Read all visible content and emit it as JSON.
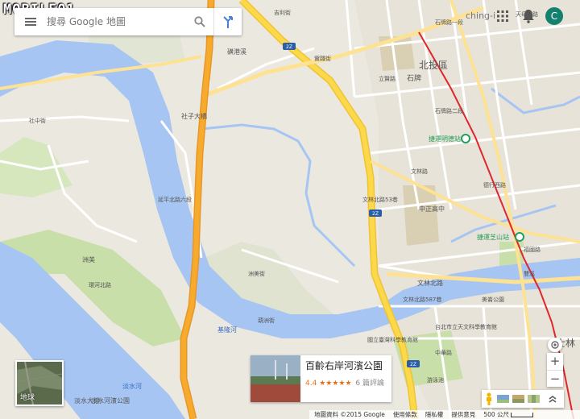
{
  "watermark": "MOBILE01",
  "search": {
    "placeholder": "搜尋 Google 地圖"
  },
  "account": {
    "name": "ching-i",
    "avatar_letter": "C"
  },
  "place_card": {
    "name": "百齡右岸河濱公園",
    "rating": "4.4",
    "stars": "★★★★★",
    "reviews": "6 篇評論"
  },
  "earth_toggle": {
    "label": "地球"
  },
  "zoom": {
    "in": "+",
    "out": "−"
  },
  "footer": {
    "data": "地圖資料 ©2015 Google",
    "terms": "使用條款",
    "privacy": "隱私權",
    "feedback": "提供意見",
    "scale": "500 公尺"
  },
  "map_labels": {
    "a": "吉利街",
    "b": "北投區",
    "c": "石牌",
    "d": "捷運明德站",
    "e": "文林北路",
    "f": "中正高中",
    "g": "捷運芝山站",
    "h": "士林",
    "i": "社子大橋",
    "j": "基隆河",
    "k": "淡水河",
    "l": "國立臺灣科學教育館",
    "m": "台北市立天文科學教育館",
    "n": "游泳池",
    "o": "洲美街",
    "p": "延平北路六段",
    "q": "環河北路",
    "r": "文林北路587巷",
    "s": "磺港溪",
    "t": "大葉高島屋",
    "u": "雙溪",
    "v": "石牌路二段",
    "w": "北投",
    "x": "立賢路",
    "y": "文林北路53巷",
    "z": "承德路七段",
    "aa": "天母東路",
    "ab": "德行西路",
    "ac": "福國路",
    "ad": "石牌路一段",
    "ae": "實踐街",
    "af": "洲美",
    "ag": "葫洲街",
    "ah": "社中街",
    "ai": "淡水大排",
    "aj": "淡水河濱公園",
    "ak": "延平北路九段",
    "al": "2Z",
    "am": "2Z",
    "an": "2Z",
    "ao": "洲美快速道路",
    "ap": "堤頂",
    "aq": "美崙公園",
    "ar": "福林路",
    "as": "中山北路六段",
    "at": "士林公園",
    "au": "中正路",
    "av": "文林路",
    "aw": "至誠路",
    "ax": "中華路",
    "ay": "承德路",
    "az": "延平北路七段"
  },
  "colors": {
    "water": "#a6c5f2",
    "park": "#c9dfa9",
    "highway": "#f7ab2c",
    "freeway_yellow": "#fcd84b",
    "mrt": "#e0262b"
  }
}
